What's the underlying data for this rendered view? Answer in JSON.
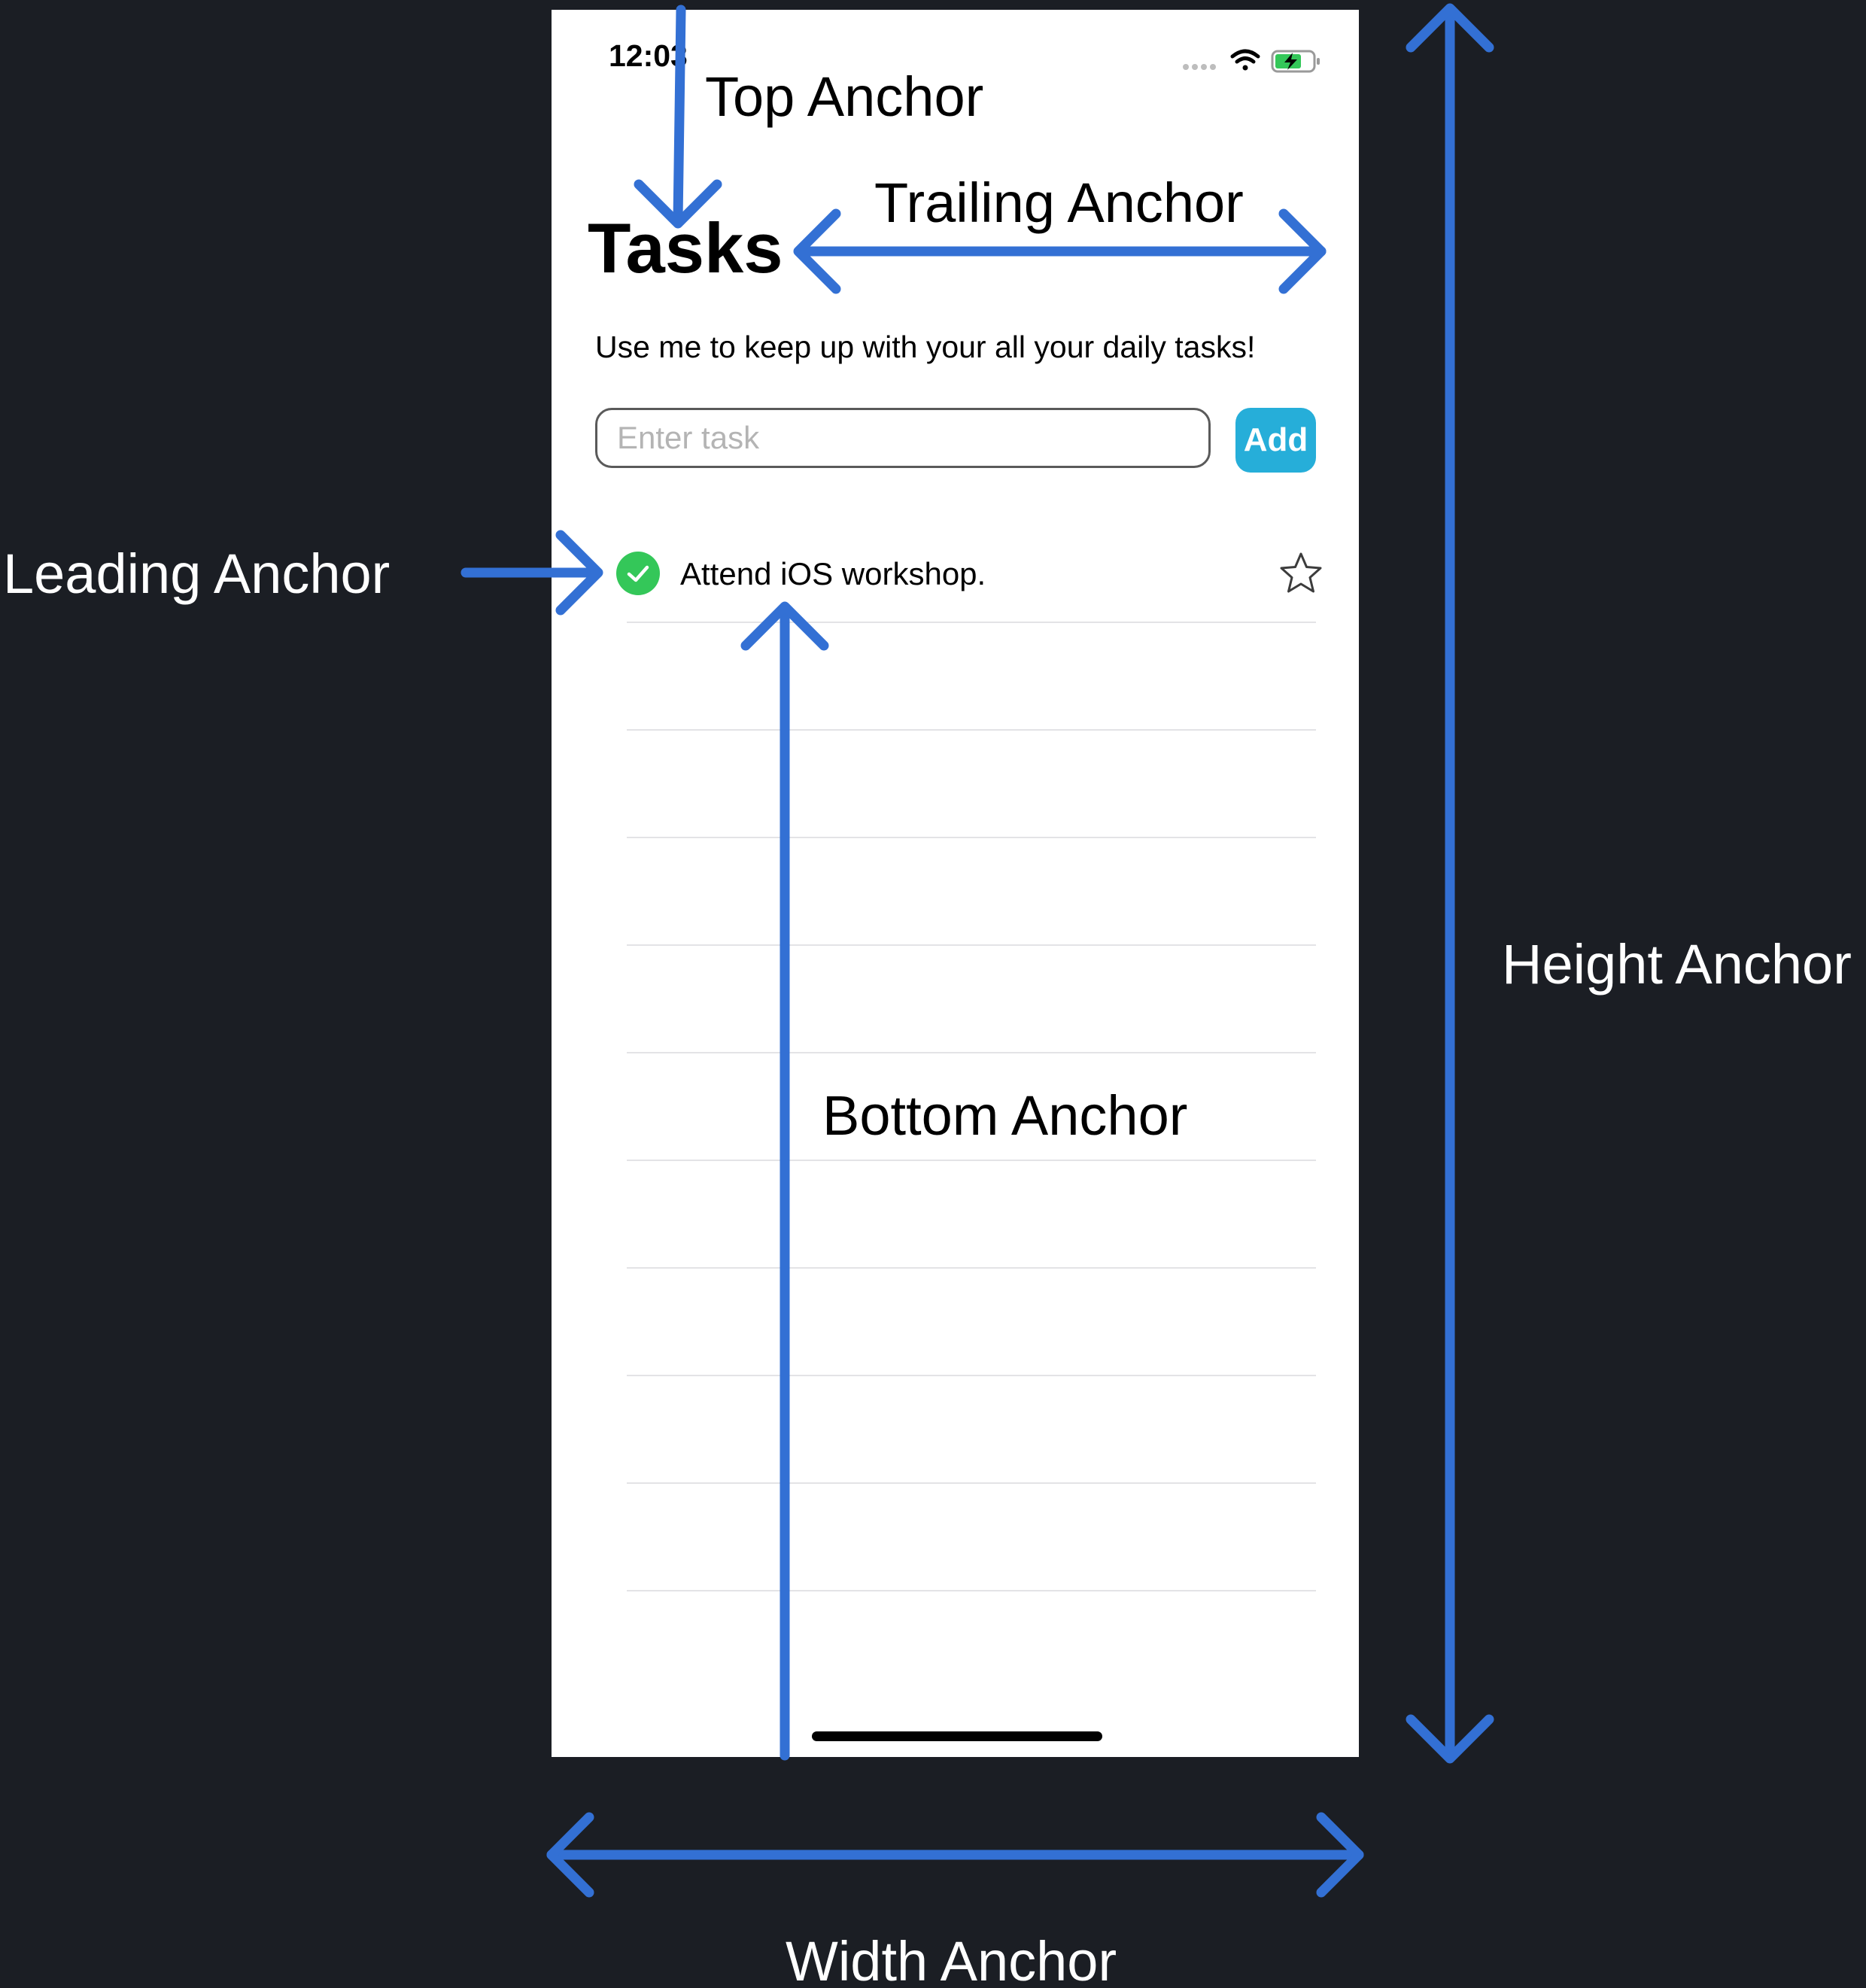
{
  "status_bar": {
    "time": "12:03",
    "icons": [
      "signal-dots-icon",
      "wifi-icon",
      "battery-charging-icon"
    ],
    "battery_color": "#34c759"
  },
  "header": {
    "title": "Tasks",
    "subtitle": "Use me to keep up with your all your daily tasks!"
  },
  "input": {
    "placeholder": "Enter task",
    "value": ""
  },
  "add_button": {
    "label": "Add",
    "color": "#26aed9"
  },
  "tasks": [
    {
      "text": "Attend iOS workshop.",
      "completed": true,
      "starred": false,
      "check_color": "#34c759"
    }
  ],
  "annotations": {
    "top": "Top Anchor",
    "trailing": "Trailing Anchor",
    "leading": "Leading Anchor",
    "bottom": "Bottom Anchor",
    "height": "Height Anchor",
    "width": "Width Anchor",
    "arrow_color": "#3370d4"
  }
}
